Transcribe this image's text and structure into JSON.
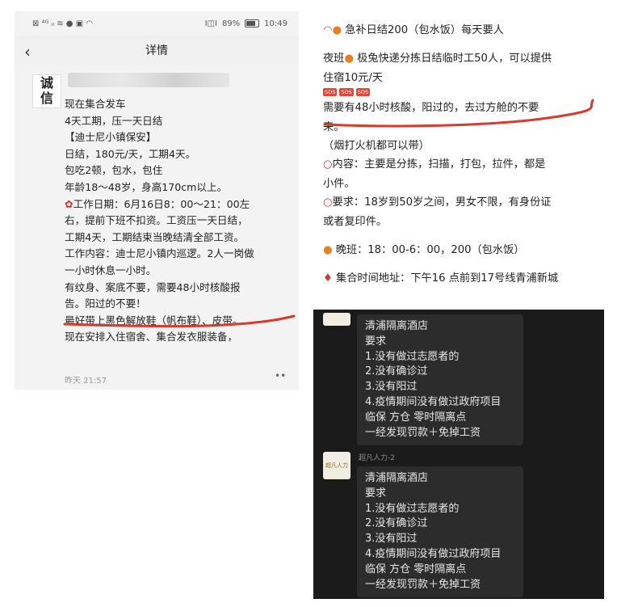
{
  "left": {
    "status": {
      "left_icons": "⊠ ⁴ᴳ ᵢₗ ≋ ● ▣ ◠",
      "battery_text": "89%",
      "time": "10:49",
      "vib": "I◫I"
    },
    "title": "详情",
    "avatar_text": [
      "诚",
      "信"
    ],
    "post_lines": [
      "现在集合发车",
      "4天工期，压一天日结",
      "【迪士尼小镇保安】",
      "日结，180元/天，工期4天。",
      "包吃2顿，包水，包住",
      "年龄18～48岁，身高170cm以上。",
      "工作日期：6月16日8：00～21：00左",
      "右，提前下班不扣资。工资压一天日结，",
      "工期4天，工期结束当晚结清全部工资。",
      "工作内容：迪士尼小镇内巡逻。2人一岗做",
      "一小时休息一小时。",
      "有纹身、案底不要，需要48小时核酸报",
      "告。阳过的不要！",
      "最好带上黑色解放鞋（帆布鞋）、皮带。",
      "现在安排入住宿舍、集合发衣服装备，"
    ],
    "timestamp": "昨天 21:57",
    "more": "••"
  },
  "right_top": {
    "lines": [
      "急补日结200（包水饭）每天要人",
      "",
      "夜班 极兔快递分拣日结临时工50人，可以提供",
      "住宿10元/天",
      "SOS SOS SOS",
      "需要有48小时核酸，阳过的，去过方舱的不要",
      "来。",
      "（烟打火机都可以带）",
      "内容：主要是分拣，扫描，打包，拉件，都是",
      "小件。",
      "要求：18岁到50岁之间，男女不限，有身份证",
      "或者复印件。",
      "",
      "晚班：18：00-6：00，200（包水饭）",
      "",
      "集合时间地址：下午16 点前到17号线青浦新城"
    ],
    "sos": "SOS"
  },
  "right_bottom": {
    "sender2": "超凡人力-2",
    "avatar_text": "超凡人力",
    "bubble_lines": [
      "清浦隔离酒店",
      "要求",
      "1.没有做过志愿者的",
      "2.没有确诊过",
      "3.没有阳过",
      "4.疫情期间没有做过政府项目",
      "临保  方仓  零时隔离点",
      "一经发现罚款＋免掉工资"
    ]
  },
  "colors": {
    "underline": "#d93a2b",
    "dark_bg": "#1b1b1b",
    "bubble": "#2c2c2c"
  }
}
